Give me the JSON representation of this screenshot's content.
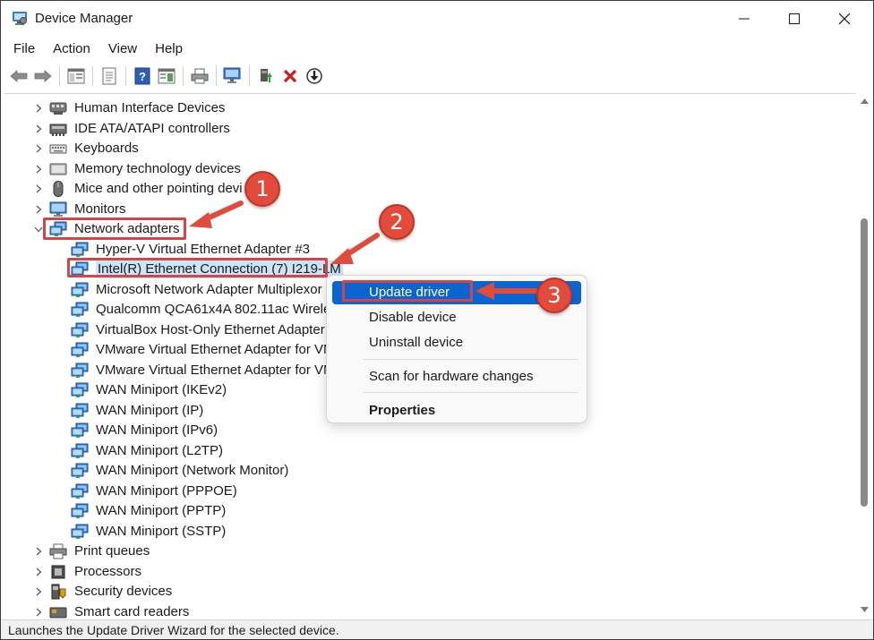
{
  "window": {
    "title": "Device Manager"
  },
  "menu": [
    "File",
    "Action",
    "View",
    "Help"
  ],
  "tree": {
    "categories_top": [
      {
        "label": "Human Interface Devices",
        "icon": "hid-icon"
      },
      {
        "label": "IDE ATA/ATAPI controllers",
        "icon": "ide-controller-icon"
      },
      {
        "label": "Keyboards",
        "icon": "keyboard-icon"
      },
      {
        "label": "Memory technology devices",
        "icon": "memory-device-icon"
      },
      {
        "label": "Mice and other pointing devi",
        "icon": "mouse-icon"
      },
      {
        "label": "Monitors",
        "icon": "monitor-icon"
      }
    ],
    "network_adapters": {
      "label": "Network adapters",
      "children": [
        "Hyper-V Virtual Ethernet Adapter #3",
        "Intel(R) Ethernet Connection (7) I219-LM",
        "Microsoft Network Adapter Multiplexor",
        "Qualcomm QCA61x4A 802.11ac Wireless",
        "VirtualBox Host-Only Ethernet Adapter",
        "VMware Virtual Ethernet Adapter for VM",
        "VMware Virtual Ethernet Adapter for VM",
        "WAN Miniport (IKEv2)",
        "WAN Miniport (IP)",
        "WAN Miniport (IPv6)",
        "WAN Miniport (L2TP)",
        "WAN Miniport (Network Monitor)",
        "WAN Miniport (PPPOE)",
        "WAN Miniport (PPTP)",
        "WAN Miniport (SSTP)"
      ],
      "selected_child": "Intel(R) Ethernet Connection (7) I219-LM"
    },
    "categories_bottom": [
      {
        "label": "Print queues",
        "icon": "printer-icon"
      },
      {
        "label": "Processors",
        "icon": "processor-icon"
      },
      {
        "label": "Security devices",
        "icon": "security-device-icon"
      },
      {
        "label": "Smart card readers",
        "icon": "smart-card-reader-icon"
      }
    ]
  },
  "context_menu": {
    "items": [
      {
        "label": "Update driver",
        "active": true
      },
      {
        "label": "Disable device"
      },
      {
        "label": "Uninstall device"
      },
      {
        "label": "Scan for hardware changes"
      },
      {
        "label": "Properties",
        "bold": true
      }
    ]
  },
  "annotations": [
    "1",
    "2",
    "3"
  ],
  "status": {
    "text": "Launches the Update Driver Wizard for the selected device."
  },
  "colors": {
    "highlight_red": "#d64545",
    "accent_blue": "#0a64d2",
    "annotation_circle": "#e24a3b"
  }
}
